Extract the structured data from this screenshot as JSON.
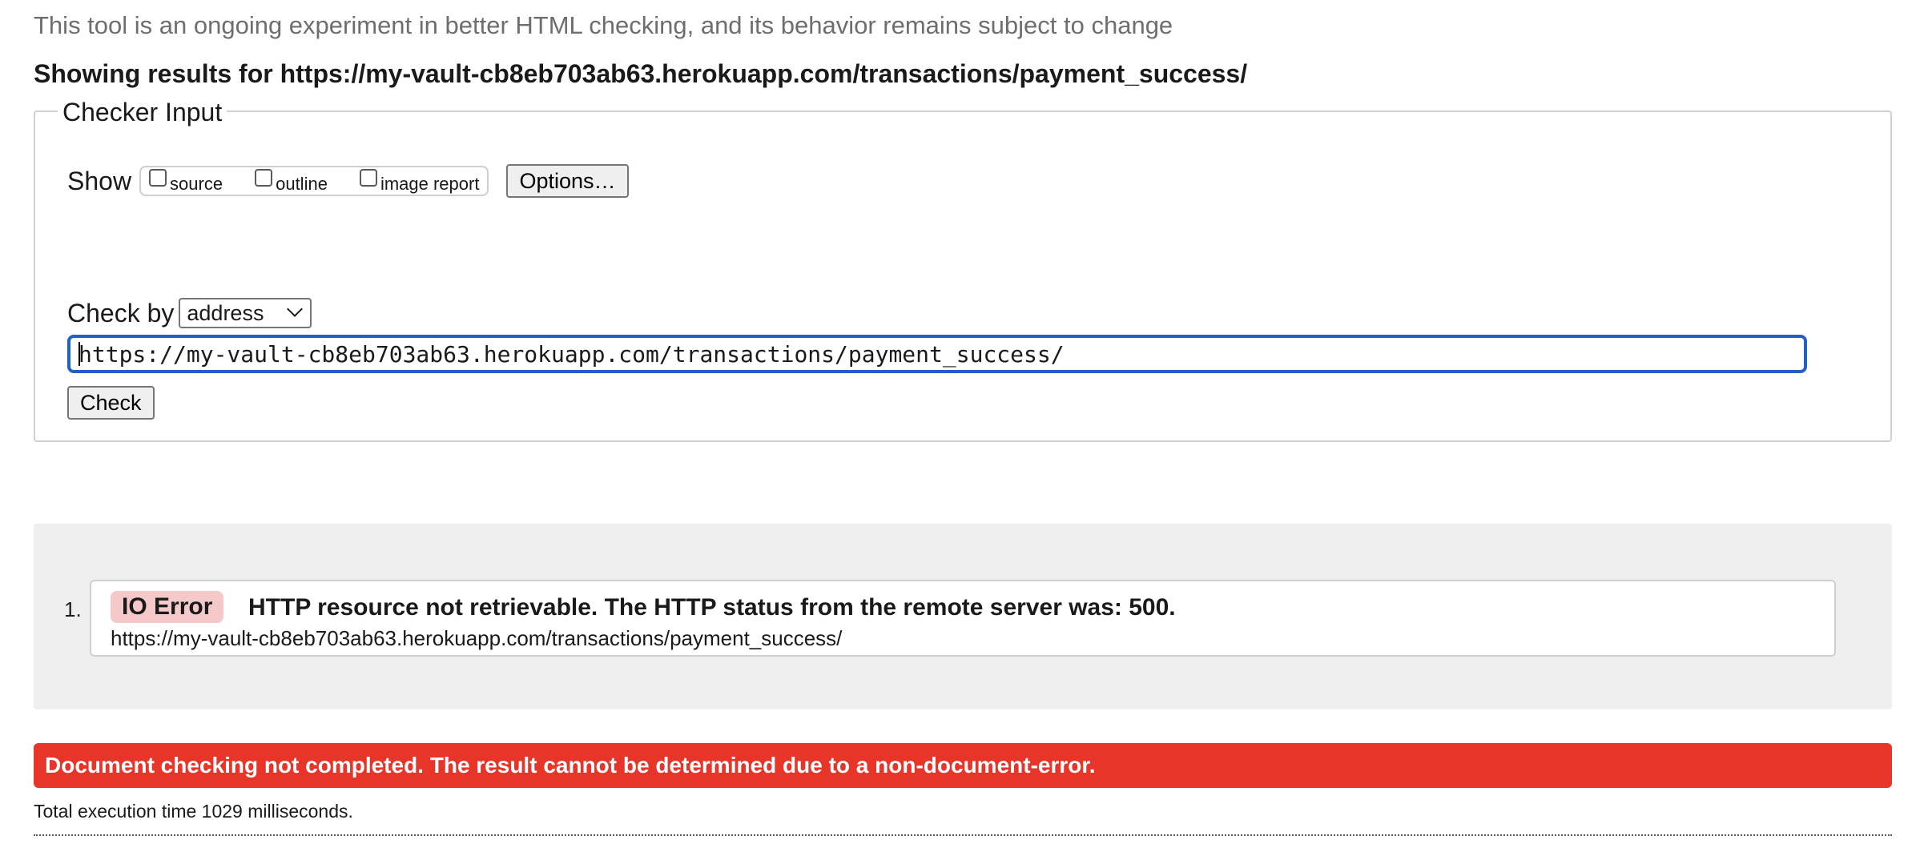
{
  "notice": "This tool is an ongoing experiment in better HTML checking, and its behavior remains subject to change",
  "results_heading": "Showing results for https://my-vault-cb8eb703ab63.herokuapp.com/transactions/payment_success/",
  "checker": {
    "legend": "Checker Input",
    "show_label": "Show",
    "show_options": [
      {
        "label": "source",
        "checked": false
      },
      {
        "label": "outline",
        "checked": false
      },
      {
        "label": "image report",
        "checked": false
      }
    ],
    "options_button": "Options…",
    "check_by_label": "Check by",
    "check_by_selected": "address",
    "url_value": "https://my-vault-cb8eb703ab63.herokuapp.com/transactions/payment_success/",
    "check_button": "Check"
  },
  "results": [
    {
      "number": "1.",
      "badge": "IO Error",
      "message": "HTTP resource not retrievable. The HTTP status from the remote server was: 500.",
      "url": "https://my-vault-cb8eb703ab63.herokuapp.com/transactions/payment_success/"
    }
  ],
  "failure_message": "Document checking not completed. The result cannot be determined due to a non-document-error.",
  "execution_time": "Total execution time 1029 milliseconds.",
  "colors": {
    "error_bar": "#e8352a",
    "error_badge": "#f5c9c9",
    "input_focus": "#1e62c8",
    "results_panel": "#efefef"
  },
  "icons": {
    "select_chevron": "chevron-down-icon"
  }
}
